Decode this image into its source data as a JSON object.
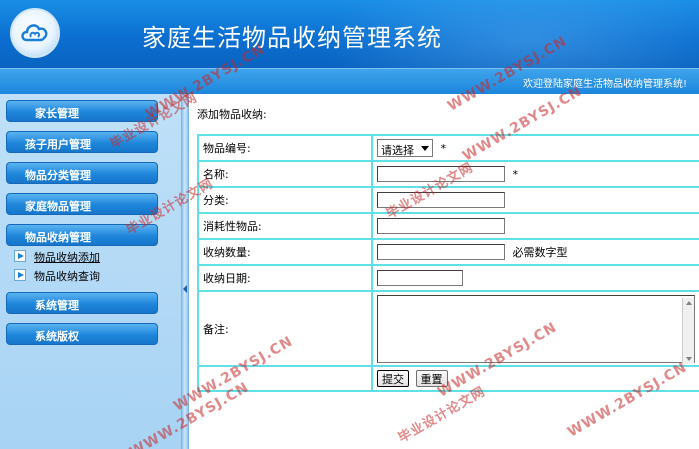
{
  "header": {
    "app_title": "家庭生活物品收纳管理系统",
    "logo_icon": "cloud-logo-icon"
  },
  "welcome_bar": {
    "text": "欢迎登陆家庭生活物品收纳管理系统!"
  },
  "sidebar": {
    "menus": [
      {
        "label": "家长管理"
      },
      {
        "label": "孩子用户管理"
      },
      {
        "label": "物品分类管理"
      },
      {
        "label": "家庭物品管理"
      },
      {
        "label": "物品收纳管理"
      },
      {
        "label": "系统管理"
      },
      {
        "label": "系统版权"
      }
    ],
    "sub_items": [
      {
        "label": "物品收纳添加",
        "active": true
      },
      {
        "label": "物品收纳查询",
        "active": false
      }
    ]
  },
  "content": {
    "heading": "添加物品收纳:",
    "form": {
      "fields": [
        {
          "label": "物品编号:",
          "select_value": "请选择",
          "required_mark": "*"
        },
        {
          "label": "名称:",
          "value": "",
          "required_mark": "*"
        },
        {
          "label": "分类:",
          "value": ""
        },
        {
          "label": "消耗性物品:",
          "value": ""
        },
        {
          "label": "收纳数量:",
          "value": "",
          "hint": "必需数字型"
        },
        {
          "label": "收纳日期:",
          "value": ""
        },
        {
          "label": "备注:",
          "value": ""
        }
      ],
      "submit_label": "提交",
      "reset_label": "重置"
    }
  },
  "watermarks": [
    "WWW.2BYSJ.CN",
    "毕业设计论文网",
    "WWW.2BYSJ.CN",
    "WWW.2BYSJ.CN",
    "毕业设计论文网",
    "WWW.2BYSJ.CN",
    "WWW.2BYSJ.CN",
    "毕业设计论文网",
    "WWW.2BYSJ.CN",
    "WWW.2BYSJ.CN",
    "毕业设计论文网"
  ],
  "colors": {
    "header_blue": "#0b6fd1",
    "sidebar_bg": "#bfe0f8",
    "menu_blue": "#1f86db",
    "table_border": "#5fe0e6",
    "watermark_red": "#c82828"
  }
}
